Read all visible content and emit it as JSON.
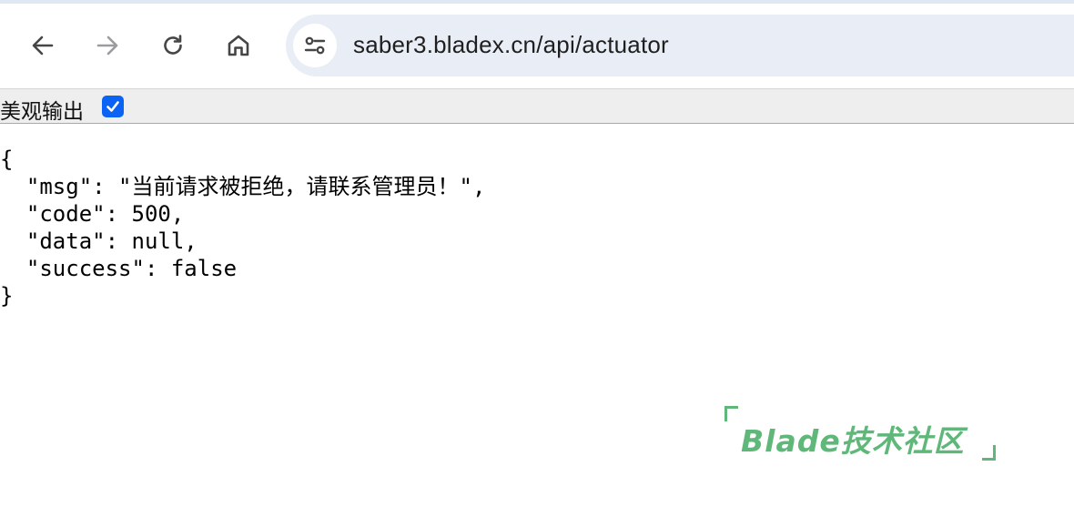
{
  "browser": {
    "url": "saber3.bladex.cn/api/actuator",
    "icons": {
      "back": "arrow-left-icon",
      "forward": "arrow-right-icon",
      "reload": "reload-icon",
      "home": "home-icon",
      "site_info": "tune-icon"
    },
    "forward_disabled": true
  },
  "pretty_print": {
    "label": "美观输出",
    "checked": true,
    "accent_color": "#0b63f6"
  },
  "json_lines": [
    "{",
    "  \"msg\": \"当前请求被拒绝，请联系管理员！\",",
    "  \"code\": 500,",
    "  \"data\": null,",
    "  \"success\": false",
    "}"
  ],
  "watermark": {
    "text": "Blade技术社区",
    "color": "#5fb87a"
  }
}
